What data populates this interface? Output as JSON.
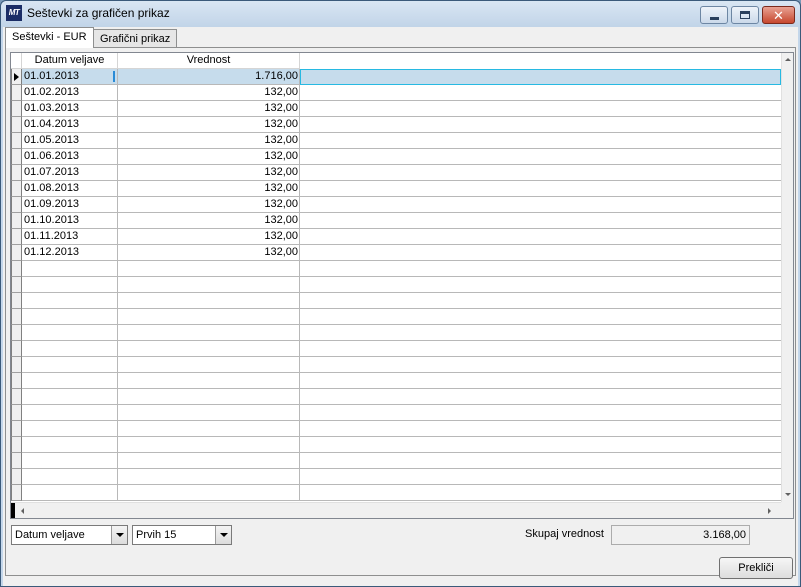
{
  "window": {
    "title": "Seštevki za grafičen prikaz",
    "app_icon_text": "MT"
  },
  "tabs": [
    {
      "label": "Seštevki - EUR",
      "active": true
    },
    {
      "label": "Grafični prikaz",
      "active": false
    }
  ],
  "grid": {
    "columns": [
      "Datum veljave",
      "Vrednost"
    ],
    "rows": [
      {
        "date": "01.01.2013",
        "value": "1.716,00",
        "selected": true
      },
      {
        "date": "01.02.2013",
        "value": "132,00"
      },
      {
        "date": "01.03.2013",
        "value": "132,00"
      },
      {
        "date": "01.04.2013",
        "value": "132,00"
      },
      {
        "date": "01.05.2013",
        "value": "132,00"
      },
      {
        "date": "01.06.2013",
        "value": "132,00"
      },
      {
        "date": "01.07.2013",
        "value": "132,00"
      },
      {
        "date": "01.08.2013",
        "value": "132,00"
      },
      {
        "date": "01.09.2013",
        "value": "132,00"
      },
      {
        "date": "01.10.2013",
        "value": "132,00"
      },
      {
        "date": "01.11.2013",
        "value": "132,00"
      },
      {
        "date": "01.12.2013",
        "value": "132,00"
      }
    ],
    "empty_rows": 15
  },
  "footer": {
    "group_by_value": "Datum veljave",
    "top_n_value": "Prvih 15",
    "total_label": "Skupaj vrednost",
    "total_value": "3.168,00",
    "cancel_label": "Prekliči"
  },
  "colors": {
    "selection": "#c6dcec",
    "selection_border": "#27b9e2",
    "close_button": "#c7472e"
  }
}
